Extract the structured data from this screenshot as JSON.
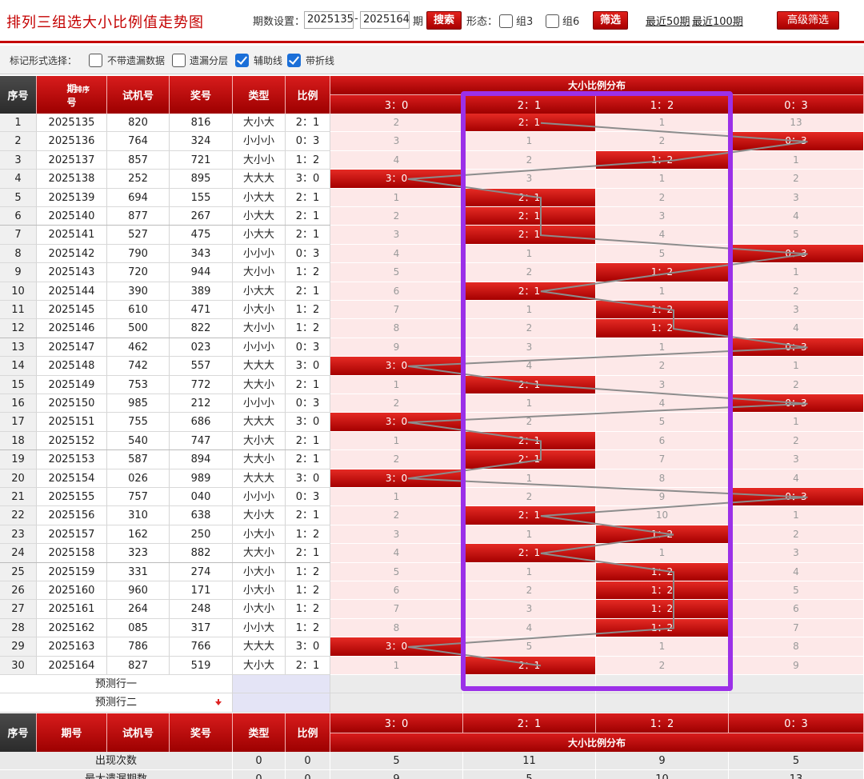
{
  "title": "排列三组选大小比例值走势图",
  "toolbar": {
    "period_label": "期数设置：",
    "period_from": "2025135",
    "dash": "-",
    "period_to": "2025164",
    "period_unit": "期",
    "search_label": "搜索",
    "shape_label": "形态：",
    "group3_label": "组3",
    "group6_label": "组6",
    "filter_label": "筛选",
    "recent50_label": "最近50期",
    "recent100_label": "最近100期",
    "advanced_label": "高级筛选"
  },
  "options": {
    "label": "标记形式选择：",
    "items": [
      {
        "label": "不带遗漏数据",
        "checked": false
      },
      {
        "label": "遗漏分层",
        "checked": false
      },
      {
        "label": "辅助线",
        "checked": true
      },
      {
        "label": "带折线",
        "checked": true
      }
    ]
  },
  "columns": {
    "seq": "序号",
    "period_a": "期",
    "period_b": "号",
    "sort": "排序",
    "trial": "试机号",
    "prize": "奖号",
    "type": "类型",
    "ratio": "比例",
    "dist": "大小比例分布",
    "dist_cols": [
      "3：0",
      "2：1",
      "1：2",
      "0：3"
    ]
  },
  "rows": [
    {
      "seq": "1",
      "period": "2025135",
      "trial": "820",
      "prize": "816",
      "type": "大小大",
      "ratio": "2：1",
      "dist": [
        "2",
        "2：1",
        "1",
        "13"
      ],
      "hit": 1
    },
    {
      "seq": "2",
      "period": "2025136",
      "trial": "764",
      "prize": "324",
      "type": "小小小",
      "ratio": "0：3",
      "dist": [
        "3",
        "1",
        "2",
        "0：3"
      ],
      "hit": 3
    },
    {
      "seq": "3",
      "period": "2025137",
      "trial": "857",
      "prize": "721",
      "type": "大小小",
      "ratio": "1：2",
      "dist": [
        "4",
        "2",
        "1：2",
        "1"
      ],
      "hit": 2
    },
    {
      "seq": "4",
      "period": "2025138",
      "trial": "252",
      "prize": "895",
      "type": "大大大",
      "ratio": "3：0",
      "dist": [
        "3：0",
        "3",
        "1",
        "2"
      ],
      "hit": 0
    },
    {
      "seq": "5",
      "period": "2025139",
      "trial": "694",
      "prize": "155",
      "type": "小大大",
      "ratio": "2：1",
      "dist": [
        "1",
        "2：1",
        "2",
        "3"
      ],
      "hit": 1
    },
    {
      "seq": "6",
      "period": "2025140",
      "trial": "877",
      "prize": "267",
      "type": "小大大",
      "ratio": "2：1",
      "dist": [
        "2",
        "2：1",
        "3",
        "4"
      ],
      "hit": 1
    },
    {
      "seq": "7",
      "period": "2025141",
      "trial": "527",
      "prize": "475",
      "type": "小大大",
      "ratio": "2：1",
      "dist": [
        "3",
        "2：1",
        "4",
        "5"
      ],
      "hit": 1
    },
    {
      "seq": "8",
      "period": "2025142",
      "trial": "790",
      "prize": "343",
      "type": "小小小",
      "ratio": "0：3",
      "dist": [
        "4",
        "1",
        "5",
        "0：3"
      ],
      "hit": 3
    },
    {
      "seq": "9",
      "period": "2025143",
      "trial": "720",
      "prize": "944",
      "type": "大小小",
      "ratio": "1：2",
      "dist": [
        "5",
        "2",
        "1：2",
        "1"
      ],
      "hit": 2
    },
    {
      "seq": "10",
      "period": "2025144",
      "trial": "390",
      "prize": "389",
      "type": "小大大",
      "ratio": "2：1",
      "dist": [
        "6",
        "2：1",
        "1",
        "2"
      ],
      "hit": 1
    },
    {
      "seq": "11",
      "period": "2025145",
      "trial": "610",
      "prize": "471",
      "type": "小大小",
      "ratio": "1：2",
      "dist": [
        "7",
        "1",
        "1：2",
        "3"
      ],
      "hit": 2
    },
    {
      "seq": "12",
      "period": "2025146",
      "trial": "500",
      "prize": "822",
      "type": "大小小",
      "ratio": "1：2",
      "dist": [
        "8",
        "2",
        "1：2",
        "4"
      ],
      "hit": 2
    },
    {
      "seq": "13",
      "period": "2025147",
      "trial": "462",
      "prize": "023",
      "type": "小小小",
      "ratio": "0：3",
      "dist": [
        "9",
        "3",
        "1",
        "0：3"
      ],
      "hit": 3
    },
    {
      "seq": "14",
      "period": "2025148",
      "trial": "742",
      "prize": "557",
      "type": "大大大",
      "ratio": "3：0",
      "dist": [
        "3：0",
        "4",
        "2",
        "1"
      ],
      "hit": 0
    },
    {
      "seq": "15",
      "period": "2025149",
      "trial": "753",
      "prize": "772",
      "type": "大大小",
      "ratio": "2：1",
      "dist": [
        "1",
        "2：1",
        "3",
        "2"
      ],
      "hit": 1
    },
    {
      "seq": "16",
      "period": "2025150",
      "trial": "985",
      "prize": "212",
      "type": "小小小",
      "ratio": "0：3",
      "dist": [
        "2",
        "1",
        "4",
        "0：3"
      ],
      "hit": 3
    },
    {
      "seq": "17",
      "period": "2025151",
      "trial": "755",
      "prize": "686",
      "type": "大大大",
      "ratio": "3：0",
      "dist": [
        "3：0",
        "2",
        "5",
        "1"
      ],
      "hit": 0
    },
    {
      "seq": "18",
      "period": "2025152",
      "trial": "540",
      "prize": "747",
      "type": "大小大",
      "ratio": "2：1",
      "dist": [
        "1",
        "2：1",
        "6",
        "2"
      ],
      "hit": 1
    },
    {
      "seq": "19",
      "period": "2025153",
      "trial": "587",
      "prize": "894",
      "type": "大大小",
      "ratio": "2：1",
      "dist": [
        "2",
        "2：1",
        "7",
        "3"
      ],
      "hit": 1
    },
    {
      "seq": "20",
      "period": "2025154",
      "trial": "026",
      "prize": "989",
      "type": "大大大",
      "ratio": "3：0",
      "dist": [
        "3：0",
        "1",
        "8",
        "4"
      ],
      "hit": 0
    },
    {
      "seq": "21",
      "period": "2025155",
      "trial": "757",
      "prize": "040",
      "type": "小小小",
      "ratio": "0：3",
      "dist": [
        "1",
        "2",
        "9",
        "0：3"
      ],
      "hit": 3
    },
    {
      "seq": "22",
      "period": "2025156",
      "trial": "310",
      "prize": "638",
      "type": "大小大",
      "ratio": "2：1",
      "dist": [
        "2",
        "2：1",
        "10",
        "1"
      ],
      "hit": 1
    },
    {
      "seq": "23",
      "period": "2025157",
      "trial": "162",
      "prize": "250",
      "type": "小大小",
      "ratio": "1：2",
      "dist": [
        "3",
        "1",
        "1：2",
        "2"
      ],
      "hit": 2
    },
    {
      "seq": "24",
      "period": "2025158",
      "trial": "323",
      "prize": "882",
      "type": "大大小",
      "ratio": "2：1",
      "dist": [
        "4",
        "2：1",
        "1",
        "3"
      ],
      "hit": 1
    },
    {
      "seq": "25",
      "period": "2025159",
      "trial": "331",
      "prize": "274",
      "type": "小大小",
      "ratio": "1：2",
      "dist": [
        "5",
        "1",
        "1：2",
        "4"
      ],
      "hit": 2
    },
    {
      "seq": "26",
      "period": "2025160",
      "trial": "960",
      "prize": "171",
      "type": "小大小",
      "ratio": "1：2",
      "dist": [
        "6",
        "2",
        "1：2",
        "5"
      ],
      "hit": 2
    },
    {
      "seq": "27",
      "period": "2025161",
      "trial": "264",
      "prize": "248",
      "type": "小大小",
      "ratio": "1：2",
      "dist": [
        "7",
        "3",
        "1：2",
        "6"
      ],
      "hit": 2
    },
    {
      "seq": "28",
      "period": "2025162",
      "trial": "085",
      "prize": "317",
      "type": "小小大",
      "ratio": "1：2",
      "dist": [
        "8",
        "4",
        "1：2",
        "7"
      ],
      "hit": 2
    },
    {
      "seq": "29",
      "period": "2025163",
      "trial": "786",
      "prize": "766",
      "type": "大大大",
      "ratio": "3：0",
      "dist": [
        "3：0",
        "5",
        "1",
        "8"
      ],
      "hit": 0
    },
    {
      "seq": "30",
      "period": "2025164",
      "trial": "827",
      "prize": "519",
      "type": "大小大",
      "ratio": "2：1",
      "dist": [
        "1",
        "2：1",
        "2",
        "9"
      ],
      "hit": 1
    }
  ],
  "predict": [
    "预测行一",
    "预测行二"
  ],
  "summary": [
    {
      "label": "出现次数",
      "type": "0",
      "ratio": "0",
      "dist": [
        "5",
        "11",
        "9",
        "5"
      ]
    },
    {
      "label": "最大遗漏期数",
      "type": "0",
      "ratio": "0",
      "dist": [
        "9",
        "5",
        "10",
        "13"
      ]
    }
  ],
  "colors": {
    "accent": "#c40000",
    "highlight_frame": "#9b30e8",
    "line": "#8c8c8c"
  }
}
